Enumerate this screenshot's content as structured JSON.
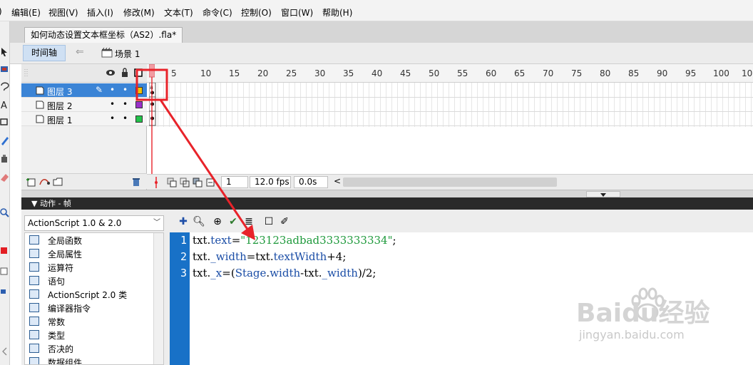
{
  "menu": {
    "items": [
      "编辑(E)",
      "视图(V)",
      "插入(I)",
      "修改(M)",
      "文本(T)",
      "命令(C)",
      "控制(O)",
      "窗口(W)",
      "帮助(H)"
    ]
  },
  "document": {
    "tab_title": "如何动态设置文本框坐标（AS2）.fla*"
  },
  "timeline": {
    "timeline_button": "时间轴",
    "scene_label": "场景 1",
    "frame_ticks": [
      "5",
      "10",
      "15",
      "20",
      "25",
      "30",
      "35",
      "40",
      "45",
      "50",
      "55",
      "60",
      "65",
      "70",
      "75",
      "80",
      "85",
      "90",
      "95",
      "100",
      "10"
    ],
    "layers": [
      {
        "name": "图层 3",
        "selected": true,
        "color": "#f2c200"
      },
      {
        "name": "图层 2",
        "selected": false,
        "color": "#9b30c9"
      },
      {
        "name": "图层 1",
        "selected": false,
        "color": "#22c34b"
      }
    ],
    "current_frame": "1",
    "fps": "12.0 fps",
    "elapsed": "0.0s"
  },
  "actions_panel": {
    "title": "动作 - 帧",
    "version_select": "ActionScript 1.0 & 2.0",
    "categories": [
      "全局函数",
      "全局属性",
      "运算符",
      "语句",
      "ActionScript 2.0 类",
      "编译器指令",
      "常数",
      "类型",
      "否决的",
      "数据组件"
    ],
    "code_lines": [
      {
        "num": "1",
        "text": "txt.text=\"123123adbad3333333334\";"
      },
      {
        "num": "2",
        "text": "txt._width=txt.textWidth+4;"
      },
      {
        "num": "3",
        "text": "txt._x=(Stage.width-txt._width)/2;"
      }
    ]
  },
  "watermark": {
    "brand": "Baidu经验",
    "url": "jingyan.baidu.com"
  },
  "colors": {
    "accent_blue": "#1871c7",
    "annotation_red": "#e8232a"
  }
}
